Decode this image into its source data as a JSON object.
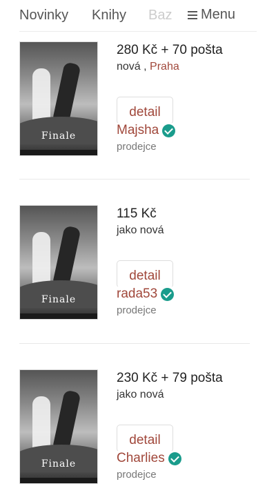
{
  "nav": {
    "items": [
      "Novinky",
      "Knihy",
      "Baz"
    ],
    "menu_label": "Menu"
  },
  "listings": [
    {
      "cover_title": "Finale",
      "price": "280 Kč + 70 pošta",
      "condition": "nová ,",
      "city": "Praha",
      "detail_label": "detail",
      "seller": "Majsha",
      "seller_label": "prodejce"
    },
    {
      "cover_title": "Finale",
      "price": "115 Kč",
      "condition": "jako nová",
      "city": "",
      "detail_label": "detail",
      "seller": "rada53",
      "seller_label": "prodejce"
    },
    {
      "cover_title": "Finale",
      "price": "230 Kč + 79 pošta",
      "condition": "jako nová",
      "city": "",
      "detail_label": "detail",
      "seller": "Charlies",
      "seller_label": "prodejce"
    }
  ],
  "colors": {
    "accent": "#a0473a",
    "verified": "#1a9c8c"
  }
}
